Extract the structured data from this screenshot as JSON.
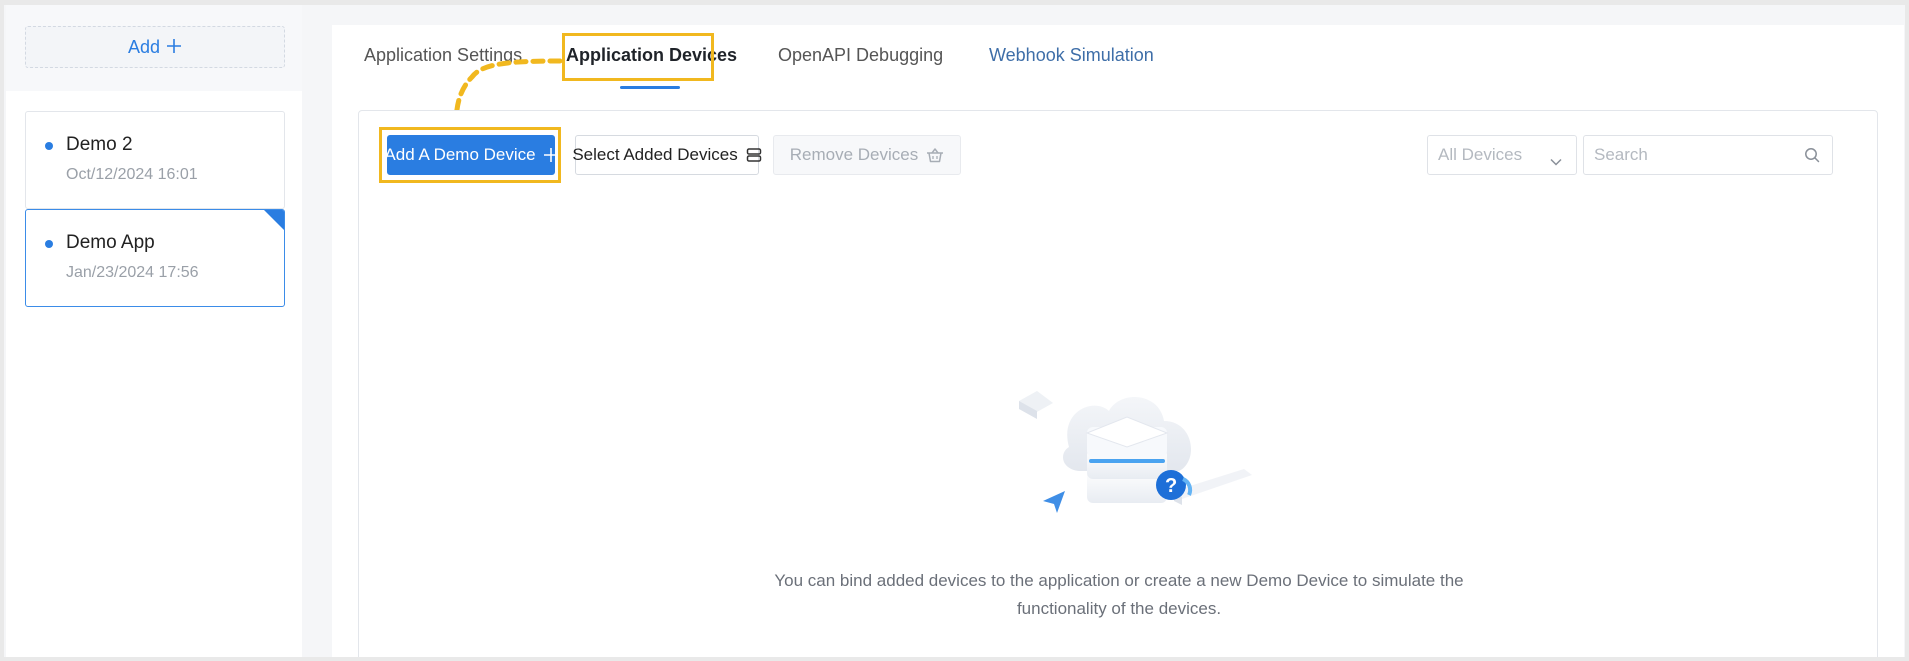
{
  "sidebar": {
    "add_label": "Add",
    "apps": [
      {
        "name": "Demo 2",
        "date": "Oct/12/2024 16:01",
        "selected": false
      },
      {
        "name": "Demo App",
        "date": "Jan/23/2024 17:56",
        "selected": true
      }
    ]
  },
  "tabs": [
    {
      "label": "Application Settings"
    },
    {
      "label": "Application Devices",
      "active": true
    },
    {
      "label": "OpenAPI Debugging"
    },
    {
      "label": "Webhook Simulation"
    }
  ],
  "toolbar": {
    "add_demo_device": "Add A Demo Device",
    "select_added_devices": "Select Added Devices",
    "remove_devices": "Remove Devices",
    "filter_value": "All Devices",
    "search_placeholder": "Search"
  },
  "empty_state": {
    "message": "You can bind added devices to the application or create a new Demo Device to simulate the functionality of the devices."
  },
  "colors": {
    "accent": "#2a7de1",
    "highlight": "#f1b81f"
  }
}
